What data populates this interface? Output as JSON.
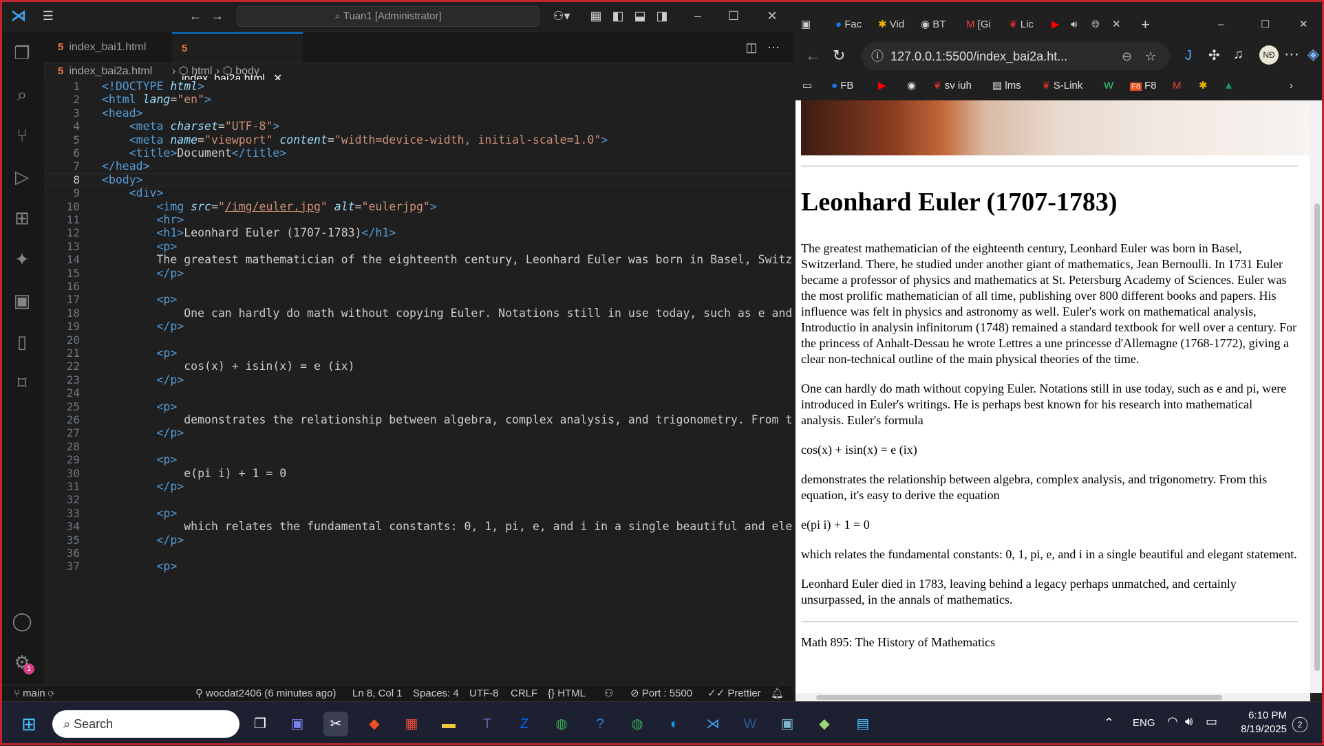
{
  "vscode": {
    "command_center": "Tuan1 [Administrator]",
    "tabs": [
      {
        "label": "index_bai1.html",
        "active": false
      },
      {
        "label": "index_bai2a.html",
        "active": true
      }
    ],
    "breadcrumb": [
      "index_bai2a.html",
      "html",
      "body"
    ],
    "code_lines": [
      [
        [
          "t",
          "<!DOCTYPE"
        ],
        [
          "tx",
          " "
        ],
        [
          "a",
          "html"
        ],
        [
          "t",
          ">"
        ]
      ],
      [
        [
          "t",
          "<html "
        ],
        [
          "a",
          "lang"
        ],
        [
          "tx",
          "="
        ],
        [
          "s",
          "\"en\""
        ],
        [
          "t",
          ">"
        ]
      ],
      [
        [
          "t",
          "<head>"
        ]
      ],
      [
        [
          "tx",
          "    "
        ],
        [
          "t",
          "<meta "
        ],
        [
          "a",
          "charset"
        ],
        [
          "tx",
          "="
        ],
        [
          "s",
          "\"UTF-8\""
        ],
        [
          "t",
          ">"
        ]
      ],
      [
        [
          "tx",
          "    "
        ],
        [
          "t",
          "<meta "
        ],
        [
          "a",
          "name"
        ],
        [
          "tx",
          "="
        ],
        [
          "s",
          "\"viewport\" "
        ],
        [
          "a",
          "content"
        ],
        [
          "tx",
          "="
        ],
        [
          "s",
          "\"width=device-width, initial-scale=1.0\""
        ],
        [
          "t",
          ">"
        ]
      ],
      [
        [
          "tx",
          "    "
        ],
        [
          "t",
          "<title>"
        ],
        [
          "tx",
          "Document"
        ],
        [
          "t",
          "</title>"
        ]
      ],
      [
        [
          "t",
          "</head>"
        ]
      ],
      [
        [
          "t",
          "<body>"
        ]
      ],
      [
        [
          "tx",
          "    "
        ],
        [
          "t",
          "<div>"
        ]
      ],
      [
        [
          "tx",
          "        "
        ],
        [
          "t",
          "<img "
        ],
        [
          "a",
          "src"
        ],
        [
          "tx",
          "="
        ],
        [
          "s",
          "\""
        ],
        [
          "sul",
          "/img/euler.jpg"
        ],
        [
          "s",
          "\" "
        ],
        [
          "a",
          "alt"
        ],
        [
          "tx",
          "="
        ],
        [
          "s",
          "\"eulerjpg\""
        ],
        [
          "t",
          ">"
        ]
      ],
      [
        [
          "tx",
          "        "
        ],
        [
          "t",
          "<hr>"
        ]
      ],
      [
        [
          "tx",
          "        "
        ],
        [
          "t",
          "<h1>"
        ],
        [
          "tx",
          "Leonhard Euler (1707-1783)"
        ],
        [
          "t",
          "</h1>"
        ]
      ],
      [
        [
          "tx",
          "        "
        ],
        [
          "t",
          "<p>"
        ]
      ],
      [
        [
          "tx",
          "        The greatest mathematician of the eighteenth century, Leonhard Euler was born in Basel, Switzerla"
        ]
      ],
      [
        [
          "tx",
          "        "
        ],
        [
          "t",
          "</p>"
        ]
      ],
      [
        [
          "tx",
          ""
        ]
      ],
      [
        [
          "tx",
          "        "
        ],
        [
          "t",
          "<p>"
        ]
      ],
      [
        [
          "tx",
          "            One can hardly do math without copying Euler. Notations still in use today, such as e and pi"
        ]
      ],
      [
        [
          "tx",
          "        "
        ],
        [
          "t",
          "</p>"
        ]
      ],
      [
        [
          "tx",
          ""
        ]
      ],
      [
        [
          "tx",
          "        "
        ],
        [
          "t",
          "<p>"
        ]
      ],
      [
        [
          "tx",
          "            cos(x) + isin(x) = e (ix)"
        ]
      ],
      [
        [
          "tx",
          "        "
        ],
        [
          "t",
          "</p>"
        ]
      ],
      [
        [
          "tx",
          ""
        ]
      ],
      [
        [
          "tx",
          "        "
        ],
        [
          "t",
          "<p>"
        ]
      ],
      [
        [
          "tx",
          "            demonstrates the relationship between algebra, complex analysis, and trigonometry. From this"
        ]
      ],
      [
        [
          "tx",
          "        "
        ],
        [
          "t",
          "</p>"
        ]
      ],
      [
        [
          "tx",
          ""
        ]
      ],
      [
        [
          "tx",
          "        "
        ],
        [
          "t",
          "<p>"
        ]
      ],
      [
        [
          "tx",
          "            e(pi i) + 1 = 0"
        ]
      ],
      [
        [
          "tx",
          "        "
        ],
        [
          "t",
          "</p>"
        ]
      ],
      [
        [
          "tx",
          ""
        ]
      ],
      [
        [
          "tx",
          "        "
        ],
        [
          "t",
          "<p>"
        ]
      ],
      [
        [
          "tx",
          "            which relates the fundamental constants: 0, 1, pi, e, and i in a single beautiful and elegant"
        ]
      ],
      [
        [
          "tx",
          "        "
        ],
        [
          "t",
          "</p>"
        ]
      ],
      [
        [
          "tx",
          ""
        ]
      ],
      [
        [
          "tx",
          "        "
        ],
        [
          "t",
          "<p>"
        ]
      ]
    ],
    "current_line": 8,
    "status": {
      "branch": "main",
      "git_blame": "wocdat2406 (6 minutes ago)",
      "position": "Ln 8, Col 1",
      "spaces": "Spaces: 4",
      "encoding": "UTF-8",
      "eol": "CRLF",
      "language": "HTML",
      "port": "Port : 5500",
      "prettier": "Prettier"
    },
    "accounts_badge": "1"
  },
  "browser": {
    "tabs": [
      "Fac",
      "Vid",
      "BT",
      "[Gi",
      "Lic"
    ],
    "url": "127.0.0.1:5500/index_bai2a.ht...",
    "profile": "NĐ",
    "favorites": [
      "FB",
      "sv iuh",
      "lms",
      "S-Link",
      "F8"
    ],
    "page": {
      "heading": "Leonhard Euler (1707-1783)",
      "paragraphs": [
        "The greatest mathematician of the eighteenth century, Leonhard Euler was born in Basel, Switzerland. There, he studied under another giant of mathematics, Jean Bernoulli. In 1731 Euler became a professor of physics and mathematics at St. Petersburg Academy of Sciences. Euler was the most prolific mathematician of all time, publishing over 800 different books and papers. His influence was felt in physics and astronomy as well. Euler's work on mathematical analysis, Introductio in analysin infinitorum (1748) remained a standard textbook for well over a century. For the princess of Anhalt-Dessau he wrote Lettres a une princesse d'Allemagne (1768-1772), giving a clear non-technical outline of the main physical theories of the time.",
        "One can hardly do math without copying Euler. Notations still in use today, such as e and pi, were introduced in Euler's writings. He is perhaps best known for his research into mathematical analysis. Euler's formula",
        "cos(x) + isin(x) = e (ix)",
        "demonstrates the relationship between algebra, complex analysis, and trigonometry. From this equation, it's easy to derive the equation",
        "e(pi i) + 1 = 0",
        "which relates the fundamental constants: 0, 1, pi, e, and i in a single beautiful and elegant statement.",
        "Leonhard Euler died in 1783, leaving behind a legacy perhaps unmatched, and certainly unsurpassed, in the annals of mathematics."
      ],
      "footer": "Math 895: The History of Mathematics"
    }
  },
  "taskbar": {
    "search_placeholder": "Search",
    "language": "ENG",
    "time": "6:10 PM",
    "date": "8/19/2025",
    "notification_count": "2"
  },
  "colors": {
    "accent": "#0078d4",
    "frame": "#c4262e"
  }
}
